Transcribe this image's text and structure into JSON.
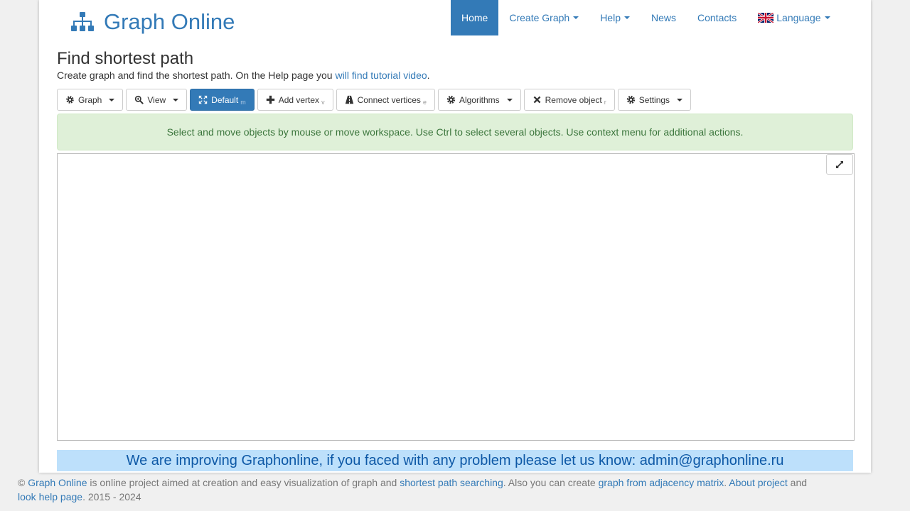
{
  "brand": {
    "title": "Graph Online",
    "icon": "sitemap-icon"
  },
  "nav": {
    "home": "Home",
    "create_graph": "Create Graph",
    "help": "Help",
    "news": "News",
    "contacts": "Contacts",
    "language": "Language"
  },
  "page": {
    "title": "Find shortest path",
    "subtitle_text": "Create graph and find the shortest path. On the Help page you ",
    "subtitle_link": "will find tutorial video",
    "subtitle_end": "."
  },
  "toolbar": {
    "graph": "Graph",
    "view": "View",
    "default": "Default",
    "default_hotkey": "m",
    "add_vertex": "Add vertex",
    "add_vertex_hotkey": "v",
    "connect_vertices": "Connect vertices",
    "connect_vertices_hotkey": "e",
    "algorithms": "Algorithms",
    "remove_object": "Remove object",
    "remove_object_hotkey": "r",
    "settings": "Settings"
  },
  "alert": {
    "message": "Select and move objects by mouse or move workspace. Use Ctrl to select several objects. Use context menu for additional actions."
  },
  "banner": {
    "message": "We are improving Graphonline, if you faced with any problem please let us know: admin@graphonline.ru"
  },
  "footer": {
    "copyright": "© ",
    "link_graph_online": "Graph Online",
    "text1": " is online project aimed at creation and easy visualization of graph and ",
    "link_shortest_path": "shortest path searching",
    "text2": ". Also you can create ",
    "link_adjacency": "graph from adjacency matrix",
    "text3": ". ",
    "link_about": "About project",
    "text4": " and ",
    "link_help": "look help page",
    "text5": ". 2015 - 2024"
  },
  "colors": {
    "primary": "#337ab7",
    "alert_bg": "#dff0d8",
    "alert_text": "#3c763d",
    "banner_bg": "#bde0fb",
    "banner_text": "#0d58a6"
  }
}
